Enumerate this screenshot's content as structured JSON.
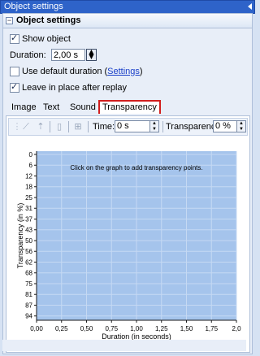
{
  "window": {
    "title": "Object settings"
  },
  "section": {
    "title": "Object settings"
  },
  "options": {
    "show_object": {
      "label": "Show object",
      "checked": true
    },
    "duration": {
      "label": "Duration:",
      "value": "2,00 s"
    },
    "use_default": {
      "label": "Use default duration (",
      "link": "Settings",
      "close": ")",
      "checked": false
    },
    "leave_in_place": {
      "label": "Leave in place after replay",
      "checked": true
    }
  },
  "tabs": [
    {
      "label": "Image"
    },
    {
      "label": "Text"
    },
    {
      "label": "Sound"
    },
    {
      "label": "Transparency",
      "active": true
    }
  ],
  "toolbar": {
    "time_label": "Time:",
    "time_value": "0 s",
    "transparency_label": "Transparency:",
    "transparency_value": "0 %"
  },
  "chart_data": {
    "type": "scatter",
    "hint": "Click on the graph to add transparency points.",
    "xlabel": "Duration (in seconds)",
    "ylabel": "Transparency (in %)",
    "x_ticks": [
      "0,00",
      "0,25",
      "0,50",
      "0,75",
      "1,00",
      "1,25",
      "1,50",
      "1,75",
      "2,0"
    ],
    "y_ticks": [
      "0",
      "6",
      "12",
      "18",
      "25",
      "31",
      "37",
      "43",
      "50",
      "56",
      "62",
      "68",
      "75",
      "81",
      "87",
      "94"
    ],
    "xlim": [
      0,
      2
    ],
    "ylim": [
      0,
      100
    ],
    "points": [],
    "colors": {
      "plot_bg": "#a5c4ec",
      "grid": "#c5d9f3",
      "frame": "#1a1a1a"
    }
  }
}
